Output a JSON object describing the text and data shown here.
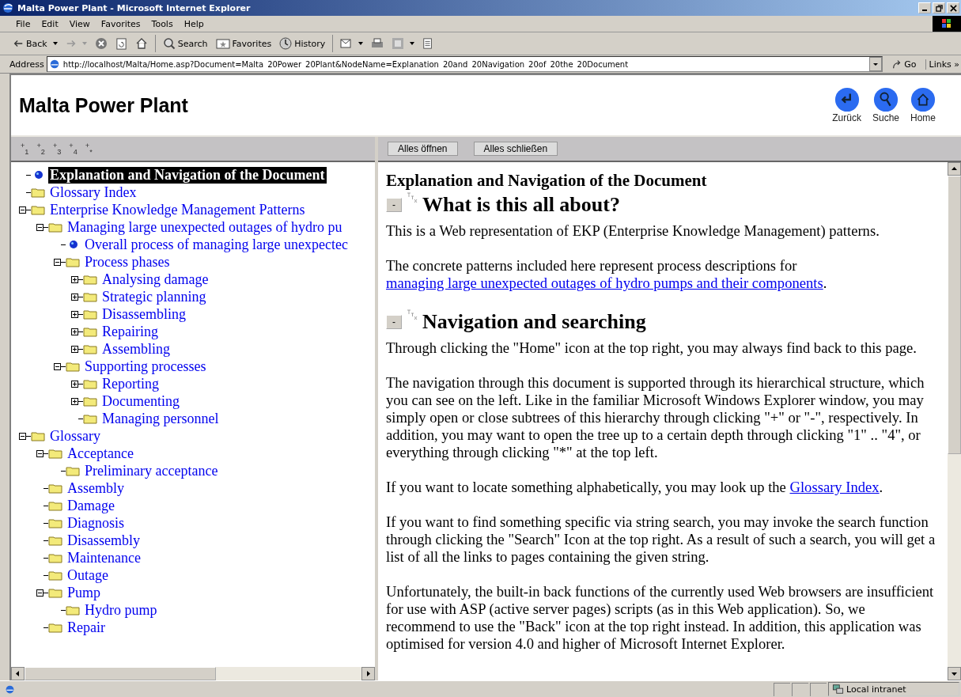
{
  "window": {
    "title": "Malta Power Plant - Microsoft Internet Explorer"
  },
  "menu": [
    "File",
    "Edit",
    "View",
    "Favorites",
    "Tools",
    "Help"
  ],
  "toolbar": [
    {
      "kind": "back",
      "label": "Back"
    },
    {
      "kind": "forward"
    },
    {
      "kind": "stop"
    },
    {
      "kind": "refresh"
    },
    {
      "kind": "home"
    },
    {
      "kind": "search",
      "label": "Search"
    },
    {
      "kind": "favorites",
      "label": "Favorites"
    },
    {
      "kind": "history",
      "label": "History"
    },
    {
      "kind": "mail"
    },
    {
      "kind": "print"
    },
    {
      "kind": "edit"
    },
    {
      "kind": "discuss"
    }
  ],
  "address": {
    "label": "Address",
    "value": "http://localhost/Malta/Home.asp?Document=Malta_20Power_20Plant&NodeName=Explanation_20and_20Navigation_20of_20the_20Document",
    "go": "Go",
    "links": "Links »"
  },
  "header": {
    "title": "Malta Power Plant",
    "nav": [
      {
        "kind": "back",
        "label": "Zurück"
      },
      {
        "kind": "search",
        "label": "Suche"
      },
      {
        "kind": "home",
        "label": "Home"
      }
    ]
  },
  "level_buttons": [
    "$^{+}$$_{1}$",
    "$^{+}$$_{2}$",
    "$^{+}$$_{3}$",
    "$^{+}$$_{4}$",
    "$^{+}$$_{*}$"
  ],
  "tree_buttons": [
    "Alles öffnen",
    "Alles schließen"
  ],
  "tree": [
    {
      "label": "Explanation and Navigation of the Document",
      "kind": "page",
      "selected": true
    },
    {
      "label": "Glossary Index",
      "kind": "folder",
      "selected": false
    },
    {
      "label": "Enterprise Knowledge Management Patterns",
      "kind": "branch",
      "expanded": true,
      "selected": false,
      "children": [
        {
          "label": "Managing large unexpected outages of hydro pu",
          "kind": "branch",
          "expanded": true,
          "selected": false,
          "children": [
            {
              "label": "Overall process of managing large unexpectec",
              "kind": "page",
              "selected": false
            },
            {
              "label": "Process phases",
              "kind": "branch",
              "expanded": true,
              "selected": false,
              "children": [
                {
                  "label": "Analysing damage",
                  "kind": "branch",
                  "expanded": false,
                  "selected": false
                },
                {
                  "label": "Strategic planning",
                  "kind": "branch",
                  "expanded": false,
                  "selected": false
                },
                {
                  "label": "Disassembling",
                  "kind": "branch",
                  "expanded": false,
                  "selected": false
                },
                {
                  "label": "Repairing",
                  "kind": "branch",
                  "expanded": false,
                  "selected": false
                },
                {
                  "label": "Assembling",
                  "kind": "branch",
                  "expanded": false,
                  "selected": false
                }
              ]
            },
            {
              "label": "Supporting processes",
              "kind": "branch",
              "expanded": true,
              "selected": false,
              "children": [
                {
                  "label": "Reporting",
                  "kind": "branch",
                  "expanded": false,
                  "selected": false
                },
                {
                  "label": "Documenting",
                  "kind": "branch",
                  "expanded": false,
                  "selected": false
                },
                {
                  "label": "Managing personnel",
                  "kind": "folder",
                  "selected": false
                }
              ]
            }
          ]
        }
      ]
    },
    {
      "label": "Glossary",
      "kind": "branch",
      "expanded": true,
      "selected": false,
      "children": [
        {
          "label": "Acceptance",
          "kind": "branch",
          "expanded": true,
          "selected": false,
          "children": [
            {
              "label": "Preliminary acceptance",
              "kind": "folder",
              "selected": false
            }
          ]
        },
        {
          "label": "Assembly",
          "kind": "folder",
          "selected": false
        },
        {
          "label": "Damage",
          "kind": "folder",
          "selected": false
        },
        {
          "label": "Diagnosis",
          "kind": "folder",
          "selected": false
        },
        {
          "label": "Disassembly",
          "kind": "folder",
          "selected": false
        },
        {
          "label": "Maintenance",
          "kind": "folder",
          "selected": false
        },
        {
          "label": "Outage",
          "kind": "folder",
          "selected": false
        },
        {
          "label": "Pump",
          "kind": "branch",
          "expanded": true,
          "selected": false,
          "children": [
            {
              "label": "Hydro pump",
              "kind": "folder",
              "selected": false
            }
          ]
        },
        {
          "label": "Repair",
          "kind": "folder",
          "selected": false
        }
      ]
    }
  ],
  "content": {
    "title": "Explanation and Navigation of the Document",
    "sections": [
      {
        "heading": "What is this all about?",
        "collapse": "-",
        "paragraphs": [
          [
            {
              "text": "This is a Web representation of EKP (Enterprise Knowledge Management) patterns.",
              "link": false
            }
          ],
          [
            {
              "text": "The concrete patterns included here represent process descriptions for ",
              "link": false
            },
            {
              "text": "managing large unexpected outages of hydro pumps and their components",
              "link": true
            },
            {
              "text": ".",
              "link": false
            }
          ]
        ]
      },
      {
        "heading": "Navigation and searching",
        "collapse": "-",
        "paragraphs": [
          [
            {
              "text": "Through clicking the \"Home\" icon at the top right, you may always find back to this page.",
              "link": false
            }
          ],
          [
            {
              "text": "The navigation through this document is supported through its hierarchical structure, which you can see on the left. Like in the familiar Microsoft Windows Explorer window, you may simply open or close subtrees of this hierarchy through clicking \"+\" or \"-\", respectively. In addition, you may want to open the tree up to a certain depth through clicking  \"1\" ..  \"4\", or everything through clicking \"*\" at the top left.",
              "link": false
            }
          ],
          [
            {
              "text": "If you want to locate something alphabetically, you may look up the ",
              "link": false
            },
            {
              "text": "Glossary Index",
              "link": true
            },
            {
              "text": ".",
              "link": false
            }
          ],
          [
            {
              "text": "If you want to find something specific via string search, you may invoke the search function through clicking the \"Search\" Icon at the top right. As a result of such a search, you will get a list of all the links to pages containing the given string.",
              "link": false
            }
          ],
          [
            {
              "text": "Unfortunately, the built-in back functions of the currently used Web browsers are insufficient for use with ASP (active server pages) scripts (as in this Web application). So, we recommend to use the \"Back\" icon at the top right instead. In addition, this application was optimised for version 4.0 and higher of Microsoft Internet Explorer.",
              "link": false
            }
          ]
        ]
      }
    ]
  },
  "status_bar": {
    "zone": "Local intranet"
  }
}
